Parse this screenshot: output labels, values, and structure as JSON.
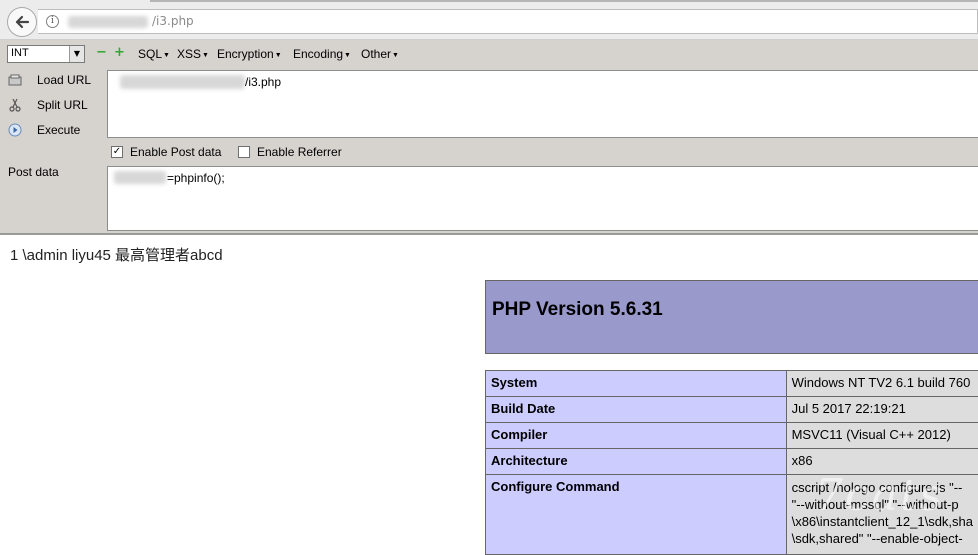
{
  "browser": {
    "url_visible": "/i3.php"
  },
  "hackbar": {
    "select_value": "INT",
    "menus": [
      "SQL",
      "XSS",
      "Encryption",
      "Encoding",
      "Other"
    ],
    "actions": {
      "load": "Load URL",
      "split": "Split URL",
      "execute": "Execute"
    },
    "url_value": "/i3.php",
    "enable_post": "Enable Post data",
    "enable_referrer": "Enable Referrer",
    "post_label": "Post data",
    "post_value": "=phpinfo();"
  },
  "page": {
    "result": "1 \\admin liyu45 最高管理者abcd",
    "php_version": "PHP Version 5.6.31",
    "rows": [
      {
        "key": "System",
        "value": "Windows NT TV2 6.1 build 760"
      },
      {
        "key": "Build Date",
        "value": "Jul 5 2017 22:19:21"
      },
      {
        "key": "Compiler",
        "value": "MSVC11 (Visual C++ 2012)"
      },
      {
        "key": "Architecture",
        "value": "x86"
      }
    ],
    "configure": {
      "key": "Configure Command",
      "lines": [
        "cscript /nologo configure.js \"--",
        "\"--without-mssql\" \"--without-p",
        "\\x86\\instantclient_12_1\\sdk,sha",
        "\\sdk,shared\" \"--enable-object-"
      ]
    },
    "watermark": "7cats"
  }
}
